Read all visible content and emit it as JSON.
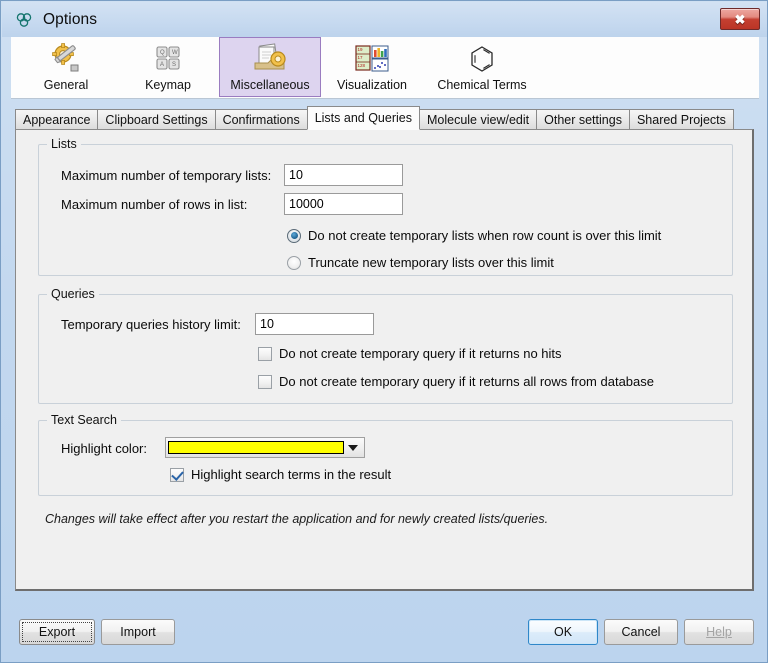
{
  "window": {
    "title": "Options",
    "title_icon": "molecule-icon",
    "close_label": "✖",
    "accent_blue": "#bcd4ee",
    "panel_bg": "#f0f0f0"
  },
  "toolbar": {
    "items": [
      {
        "label": "General",
        "icon": "gear-wrench-icon",
        "selected": false
      },
      {
        "label": "Keymap",
        "icon": "keyboard-keys-icon",
        "selected": false
      },
      {
        "label": "Miscellaneous",
        "icon": "documents-gear-icon",
        "selected": true
      },
      {
        "label": "Visualization",
        "icon": "table-chart-icon",
        "selected": false
      },
      {
        "label": "Chemical Terms",
        "icon": "benzene-ring-icon",
        "selected": false
      }
    ],
    "selected_bg": "#ddd4ef",
    "selected_border": "#9a7cc0"
  },
  "tabs": [
    {
      "label": "Appearance",
      "active": false
    },
    {
      "label": "Clipboard Settings",
      "active": false
    },
    {
      "label": "Confirmations",
      "active": false
    },
    {
      "label": "Lists and Queries",
      "active": true
    },
    {
      "label": "Molecule view/edit",
      "active": false
    },
    {
      "label": "Other settings",
      "active": false
    },
    {
      "label": "Shared Projects",
      "active": false
    }
  ],
  "lists_group": {
    "title": "Lists",
    "max_temp_lists_label": "Maximum number of temporary lists:",
    "max_temp_lists_value": "10",
    "max_rows_label": "Maximum number of rows in list:",
    "max_rows_value": "10000",
    "radio_options": [
      {
        "label": "Do not create temporary lists when row count is over this limit",
        "selected": true
      },
      {
        "label": "Truncate new temporary lists over this limit",
        "selected": false
      }
    ]
  },
  "queries_group": {
    "title": "Queries",
    "history_limit_label": "Temporary queries history limit:",
    "history_limit_value": "10",
    "checkboxes": [
      {
        "label": "Do not create temporary query if it returns no hits",
        "checked": false
      },
      {
        "label": "Do not create temporary query if it returns all rows from database",
        "checked": false
      }
    ]
  },
  "text_search_group": {
    "title": "Text Search",
    "highlight_color_label": "Highlight color:",
    "highlight_color_value": "#FFFF00",
    "highlight_checkbox": {
      "label": "Highlight search terms in the result",
      "checked": true
    }
  },
  "note": "Changes will take effect after you restart the application and for newly created lists/queries.",
  "buttons": {
    "export": "Export",
    "import": "Import",
    "ok": "OK",
    "cancel": "Cancel",
    "help": "Help"
  }
}
